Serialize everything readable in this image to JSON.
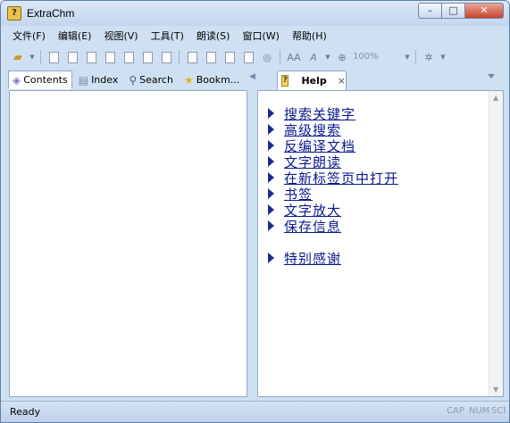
{
  "window": {
    "title": "ExtraChm",
    "controls": {
      "minimize": "–",
      "maximize": "□",
      "close": "✕"
    }
  },
  "menu": [
    "文件(F)",
    "编辑(E)",
    "视图(V)",
    "工具(T)",
    "朗读(S)",
    "窗口(W)",
    "帮助(H)"
  ],
  "toolbar": {
    "zoom_value": "100%",
    "font_label": "AA"
  },
  "left_tabs": [
    {
      "label": "Contents",
      "icon": "book-icon",
      "active": true
    },
    {
      "label": "Index",
      "icon": "index-icon",
      "active": false
    },
    {
      "label": "Search",
      "icon": "search-icon",
      "active": false
    },
    {
      "label": "Bookm...",
      "icon": "star-icon",
      "active": false
    }
  ],
  "right_tab": {
    "label": "Help",
    "icon": "help-icon",
    "close": "×"
  },
  "help_links": [
    "搜索关键字",
    "高级搜索",
    "反编译文档",
    "文字朗读",
    "在新标签页中打开",
    "书签",
    "文字放大",
    "保存信息",
    "特别感谢"
  ],
  "status": {
    "text": "Ready",
    "cap": "CAP",
    "num": "NUM",
    "scrl": "SCRL"
  },
  "colors": {
    "window_frame": "#cfe0f3",
    "link": "#0a1a8c",
    "bullet": "#1f2b8a"
  }
}
